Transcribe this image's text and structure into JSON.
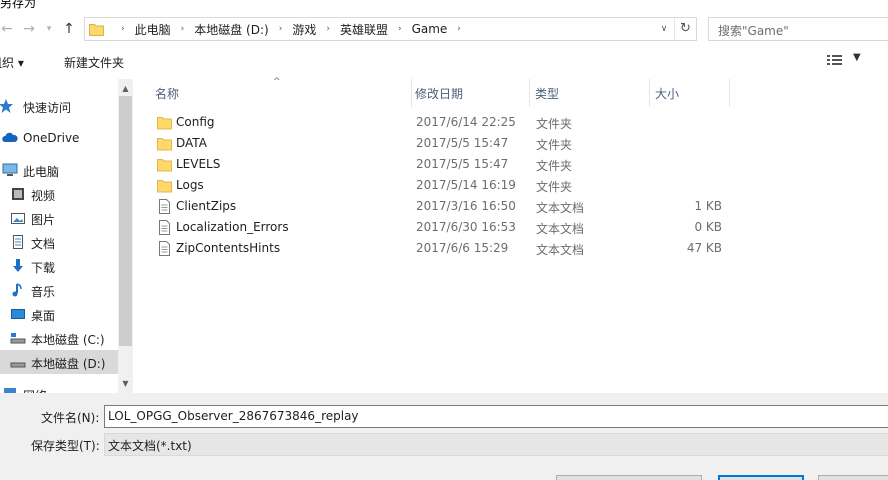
{
  "window": {
    "title": "另存为"
  },
  "address": {
    "crumbs": [
      "此电脑",
      "本地磁盘 (D:)",
      "游戏",
      "英雄联盟",
      "Game"
    ],
    "search_placeholder": "搜索\"Game\""
  },
  "toolbar": {
    "organize_label": "组织 ▾",
    "new_folder_label": "新建文件夹"
  },
  "sidebar": {
    "items": [
      {
        "label": "快速访问",
        "icon": "star-icon"
      },
      {
        "label": "OneDrive",
        "icon": "cloud-icon"
      },
      {
        "label": "此电脑",
        "icon": "computer-icon"
      },
      {
        "label": "视频",
        "icon": "video-icon"
      },
      {
        "label": "图片",
        "icon": "picture-icon"
      },
      {
        "label": "文档",
        "icon": "document-icon"
      },
      {
        "label": "下载",
        "icon": "download-icon"
      },
      {
        "label": "音乐",
        "icon": "music-icon"
      },
      {
        "label": "桌面",
        "icon": "desktop-icon"
      },
      {
        "label": "本地磁盘 (C:)",
        "icon": "drive-icon"
      },
      {
        "label": "本地磁盘 (D:)",
        "icon": "drive-icon"
      },
      {
        "label": "网络",
        "icon": "network-icon"
      }
    ]
  },
  "columns": {
    "name": "名称",
    "date": "修改日期",
    "type": "类型",
    "size": "大小"
  },
  "files": [
    {
      "name": "Config",
      "date": "2017/6/14 22:25",
      "type": "文件夹",
      "size": "",
      "kind": "folder"
    },
    {
      "name": "DATA",
      "date": "2017/5/5 15:47",
      "type": "文件夹",
      "size": "",
      "kind": "folder"
    },
    {
      "name": "LEVELS",
      "date": "2017/5/5 15:47",
      "type": "文件夹",
      "size": "",
      "kind": "folder"
    },
    {
      "name": "Logs",
      "date": "2017/5/14 16:19",
      "type": "文件夹",
      "size": "",
      "kind": "folder"
    },
    {
      "name": "ClientZips",
      "date": "2017/3/16 16:50",
      "type": "文本文档",
      "size": "1 KB",
      "kind": "file"
    },
    {
      "name": "Localization_Errors",
      "date": "2017/6/30 16:53",
      "type": "文本文档",
      "size": "0 KB",
      "kind": "file"
    },
    {
      "name": "ZipContentsHints",
      "date": "2017/6/6 15:29",
      "type": "文本文档",
      "size": "47 KB",
      "kind": "file"
    }
  ],
  "save": {
    "filename_label": "文件名(N):",
    "filename_value": "LOL_OPGG_Observer_2867673846_replay",
    "filetype_label": "保存类型(T):",
    "filetype_value": "文本文档(*.txt)"
  },
  "colors": {
    "accent": "#0078d7",
    "folder": "#ffd86b",
    "header_text": "#4c607a"
  }
}
